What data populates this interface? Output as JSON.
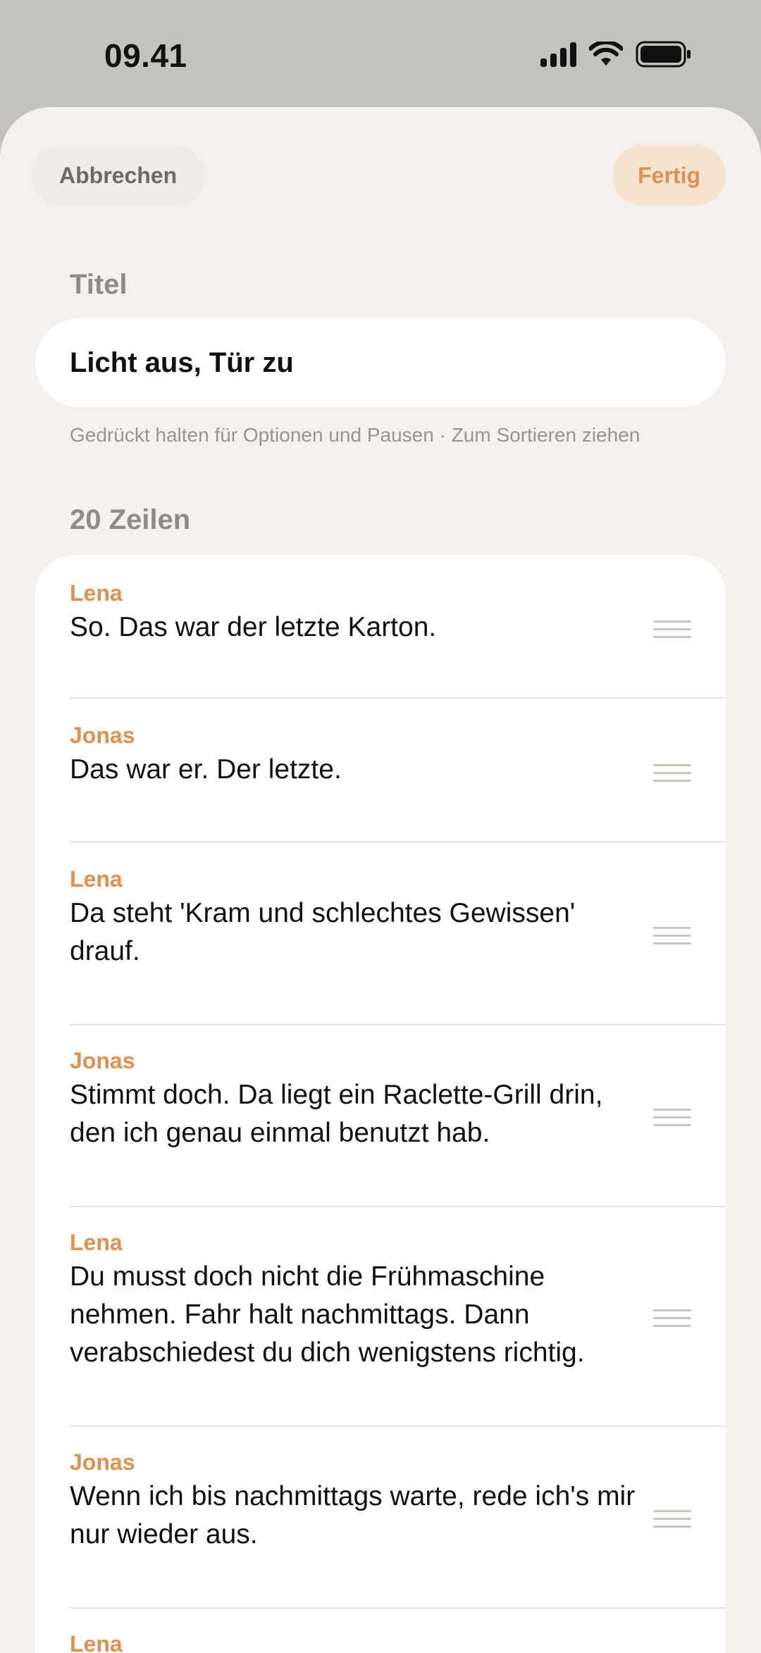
{
  "status_bar": {
    "time": "09.41"
  },
  "header": {
    "cancel_label": "Abbrechen",
    "done_label": "Fertig"
  },
  "title_section": {
    "label": "Titel",
    "value": "Licht aus, Tür zu"
  },
  "hint": "Gedrückt halten für Optionen und Pausen · Zum Sortieren ziehen",
  "lines_section": {
    "label": "20 Zeilen",
    "lines": [
      {
        "speaker": "Lena",
        "text": "So. Das war der letzte Karton."
      },
      {
        "speaker": "Jonas",
        "text": "Das war er. Der letzte."
      },
      {
        "speaker": "Lena",
        "text": "Da steht 'Kram und schlechtes Gewissen' drauf."
      },
      {
        "speaker": "Jonas",
        "text": "Stimmt doch. Da liegt ein Raclette-Grill drin, den ich genau einmal benutzt hab."
      },
      {
        "speaker": "Lena",
        "text": "Du musst doch nicht die Frühmaschine nehmen. Fahr halt nachmittags. Dann verabschiedest du dich wenigstens richtig."
      },
      {
        "speaker": "Jonas",
        "text": "Wenn ich bis nachmittags warte, rede ich's mir nur wieder aus."
      },
      {
        "speaker": "Lena",
        "text": ""
      }
    ]
  },
  "colors": {
    "accent": "#e0914f",
    "background": "#f4f1ec",
    "card": "#ffffff",
    "status_bg": "#c3c2bc"
  }
}
